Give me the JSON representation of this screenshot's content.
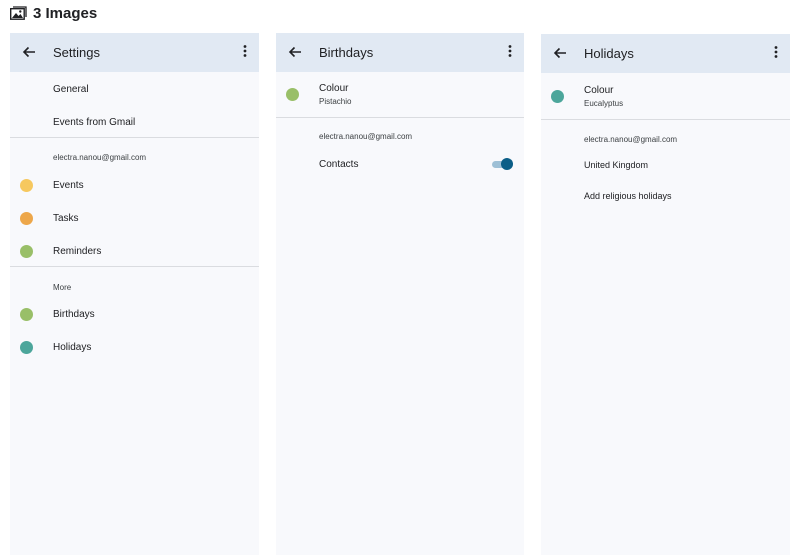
{
  "page": {
    "title": "3 Images",
    "icon": "images-icon"
  },
  "colors": {
    "app_bar": "#e1e9f3",
    "panel_bg": "#f8f9fc",
    "events": "#f6c85f",
    "tasks": "#eda74a",
    "reminders": "#99bf68",
    "birthdays": "#99bf68",
    "holidays": "#4ca69b",
    "toggle_on": "#0b5e87"
  },
  "settings": {
    "title": "Settings",
    "general_label": "General",
    "gmail_events_label": "Events from Gmail",
    "account": "electra.nanou@gmail.com",
    "account_items": [
      {
        "label": "Events",
        "color": "#f6c85f"
      },
      {
        "label": "Tasks",
        "color": "#eda74a"
      },
      {
        "label": "Reminders",
        "color": "#99bf68"
      }
    ],
    "more_heading": "More",
    "more_items": [
      {
        "label": "Birthdays",
        "color": "#99bf68"
      },
      {
        "label": "Holidays",
        "color": "#4ca69b"
      }
    ]
  },
  "birthdays": {
    "title": "Birthdays",
    "colour_label": "Colour",
    "colour_value": "Pistachio",
    "account": "electra.nanou@gmail.com",
    "contacts_label": "Contacts",
    "contacts_enabled": true
  },
  "holidays": {
    "title": "Holidays",
    "colour_label": "Colour",
    "colour_value": "Eucalyptus",
    "account": "electra.nanou@gmail.com",
    "country": "United Kingdom",
    "add_religious_label": "Add religious holidays"
  }
}
